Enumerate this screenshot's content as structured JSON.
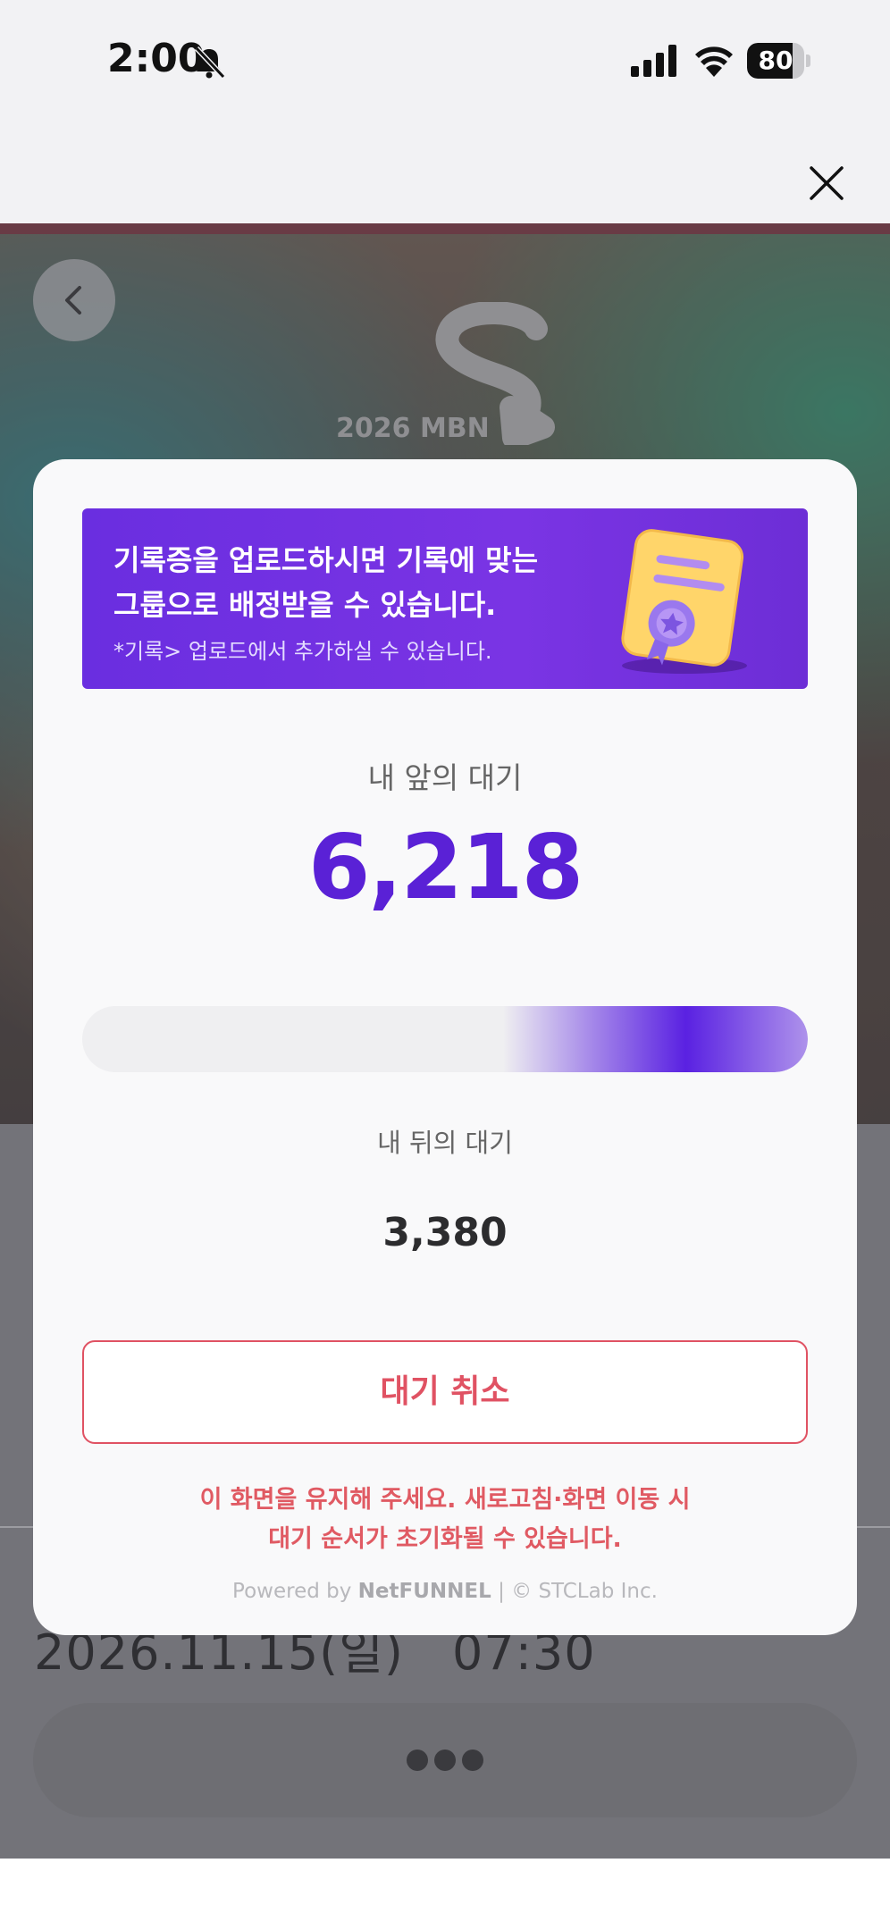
{
  "status_bar": {
    "time": "2:00",
    "battery_percent": "80",
    "battery_level": 0.8
  },
  "background": {
    "logo_text": "2026 MBN",
    "date": "2026.11.15(일)",
    "time": "07:30"
  },
  "modal": {
    "banner": {
      "line1": "기록증을 업로드하시면 기록에 맞는",
      "line2": "그룹으로 배정받을 수 있습니다.",
      "note": "*기록> 업로드에서 추가하실 수 있습니다."
    },
    "ahead_label": "내 앞의 대기",
    "ahead_count": "6,218",
    "progress": 0.42,
    "behind_label": "내 뒤의 대기",
    "behind_count": "3,380",
    "cancel_label": "대기 취소",
    "warning_line1": "이 화면을 유지해 주세요. 새로고침·화면 이동 시",
    "warning_line2": "대기 순서가 초기화될 수 있습니다.",
    "powered_prefix": "Powered by",
    "powered_brand": "NetFUNNEL",
    "powered_suffix": "| © STCLab Inc."
  },
  "colors": {
    "accent": "#5a21d6",
    "danger": "#e05263",
    "banner": "#6a2ee0"
  },
  "icons": {
    "bell": "bell-slash-icon",
    "signal": "cellular-signal-icon",
    "wifi": "wifi-icon",
    "close": "close-icon",
    "back": "chevron-left-icon",
    "certificate": "certificate-icon"
  }
}
